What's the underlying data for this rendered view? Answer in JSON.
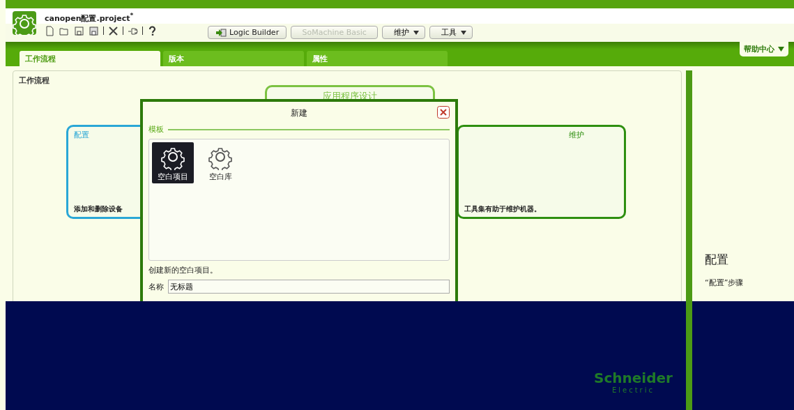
{
  "window": {
    "title": "canopen配置.project$^{*}$"
  },
  "toolbar": {
    "buttons": [
      {
        "label": "Logic Builder",
        "disabled": false
      },
      {
        "label": "SoMachine Basic",
        "disabled": true
      }
    ],
    "menus": [
      {
        "label": "维护"
      },
      {
        "label": "工具"
      }
    ],
    "help": "帮助中心"
  },
  "tabs": [
    {
      "label": "工作流程",
      "selected": true
    },
    {
      "label": "版本",
      "selected": false
    },
    {
      "label": "属性",
      "selected": false
    }
  ],
  "panel": {
    "title": "工作流程"
  },
  "workflow": [
    {
      "label": "应用程序设计",
      "color": "#7cc242"
    },
    {
      "label": "配置",
      "color": "#2aa7d6",
      "text": "添加和删除设备"
    },
    {
      "label": "维护",
      "color": "#2e8f10",
      "text": "工具集有助于维护机器。"
    }
  ],
  "dialog": {
    "title": "新建",
    "section": "模板",
    "templates": [
      {
        "label": "空白项目",
        "selected": true
      },
      {
        "label": "空白库",
        "selected": false
      }
    ],
    "description": "创建新的空白项目。",
    "name_label": "名称",
    "name_value": "无标题"
  },
  "help_pane": {
    "heading": "配置",
    "text": "“配置”步骤"
  },
  "logo": {
    "line1": "Schneider",
    "line2": "Electric"
  }
}
